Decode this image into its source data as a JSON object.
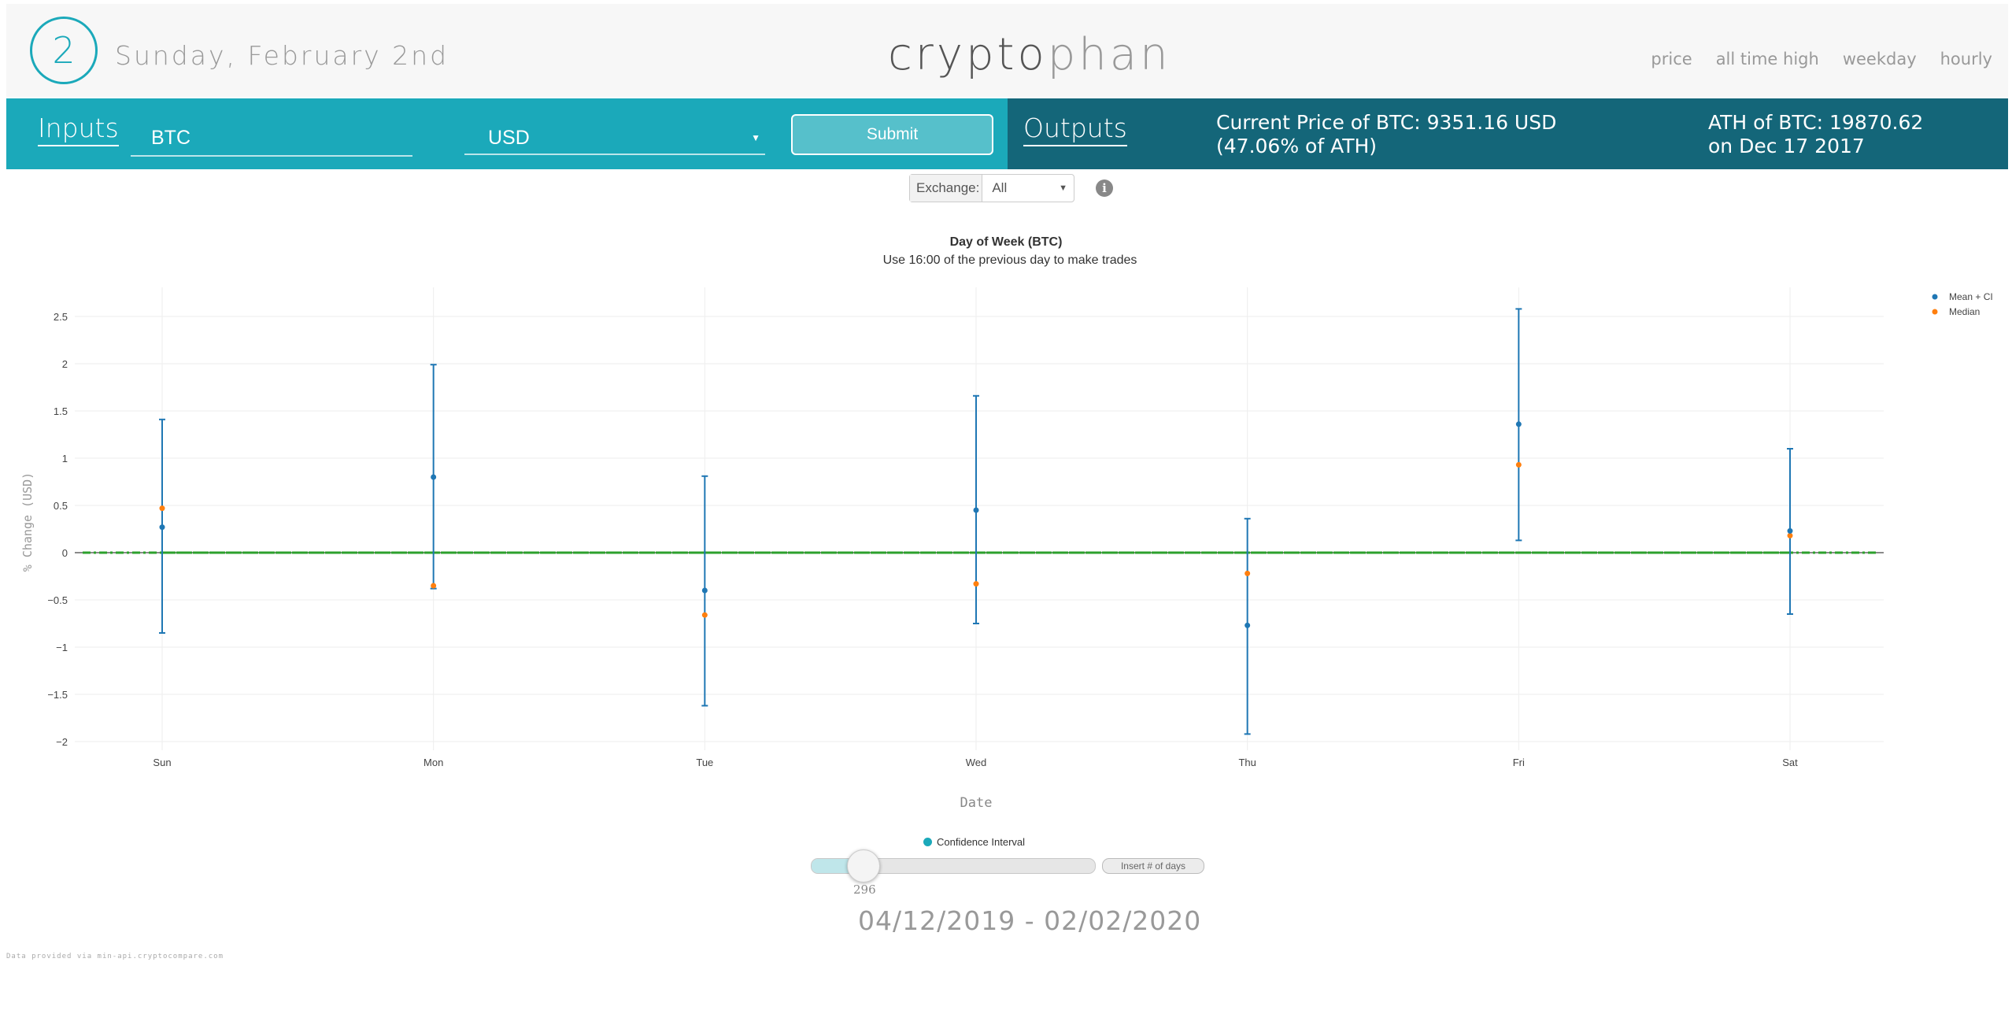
{
  "header": {
    "day_number": "2",
    "date": "Sunday, February 2nd",
    "logo_part1": "crypto",
    "logo_part2": "phan",
    "nav": [
      "price",
      "all time high",
      "weekday",
      "hourly"
    ]
  },
  "inputs": {
    "heading": "Inputs",
    "coin": "BTC",
    "currency": "USD",
    "submit_label": "Submit"
  },
  "outputs": {
    "heading": "Outputs",
    "current_price_line1": "Current Price of BTC: 9351.16 USD",
    "current_price_line2": "(47.06% of ATH)",
    "ath_line1": "ATH of BTC: 19870.62",
    "ath_line2": "on Dec 17 2017"
  },
  "exchange": {
    "label": "Exchange:",
    "value": "All",
    "info": "i"
  },
  "chart_data": {
    "type": "scatter",
    "title": "Day of Week (BTC)",
    "subtitle": "Use 16:00 of the previous day to make trades",
    "xlabel": "Date",
    "ylabel": "% Change (USD)",
    "categories": [
      "Sun",
      "Mon",
      "Tue",
      "Wed",
      "Thu",
      "Fri",
      "Sat"
    ],
    "ylim": [
      -2,
      2.6
    ],
    "yticks": [
      -2,
      -1.5,
      -1,
      -0.5,
      0,
      0.5,
      1,
      1.5,
      2,
      2.5
    ],
    "ytick_labels": [
      "−2",
      "−1.5",
      "−1",
      "−0.5",
      "0",
      "0.5",
      "1",
      "1.5",
      "2",
      "2.5"
    ],
    "grid": true,
    "legend_position": "top-right",
    "series": [
      {
        "name": "Mean + CI",
        "color": "#1f77b4",
        "values": [
          0.27,
          0.8,
          -0.4,
          0.45,
          -0.77,
          1.36,
          0.23
        ],
        "ci_low": [
          -0.85,
          -0.38,
          -1.62,
          -0.75,
          -1.92,
          0.13,
          -0.65
        ],
        "ci_high": [
          1.41,
          1.99,
          0.81,
          1.66,
          0.36,
          2.58,
          1.1
        ]
      },
      {
        "name": "Median",
        "color": "#ff7f0e",
        "values": [
          0.47,
          -0.35,
          -0.66,
          -0.33,
          -0.22,
          0.93,
          0.18
        ]
      },
      {
        "color": "#2ca02c",
        "values": [
          0,
          0,
          0,
          0,
          0,
          0,
          0
        ]
      }
    ]
  },
  "slider": {
    "legend_label": "Confidence Interval",
    "value": "296",
    "fill_fraction": 0.13,
    "days_placeholder": "Insert # of days"
  },
  "date_range": "04/12/2019 - 02/02/2020",
  "footer": "Data provided via min-api.cryptocompare.com"
}
